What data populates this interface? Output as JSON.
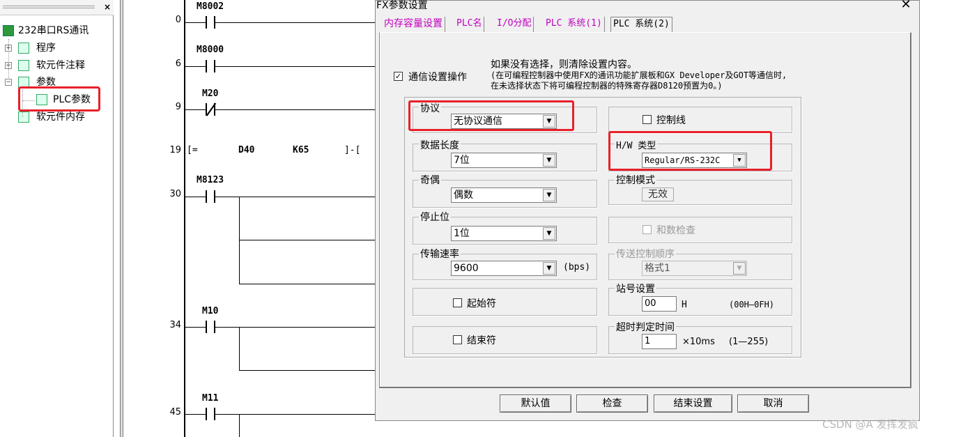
{
  "tree": {
    "close_glyph": "×",
    "root_label": "232串口RS通讯",
    "items": [
      {
        "label": "程序",
        "expander": "+"
      },
      {
        "label": "软元件注释",
        "expander": "+"
      },
      {
        "label": "参数",
        "expander": "−"
      },
      {
        "label": "PLC参数",
        "expander": ""
      },
      {
        "label": "软元件内存",
        "expander": ""
      }
    ]
  },
  "ladder": {
    "rungs": [
      {
        "step": "0",
        "device": "M8002"
      },
      {
        "step": "6",
        "device": "M8000"
      },
      {
        "step": "9",
        "device": "M20"
      },
      {
        "step": "19",
        "device": ""
      },
      {
        "step": "30",
        "device": "M8123"
      },
      {
        "step": "34",
        "device": "M10"
      },
      {
        "step": "45",
        "device": "M11"
      }
    ],
    "compare": {
      "open": "[=",
      "op1": "D40",
      "op2": "K65",
      "close": "]-["
    }
  },
  "dialog": {
    "title": "FX参数设置",
    "close_glyph": "✕",
    "tabs": [
      "内存容量设置",
      "PLC名",
      "I/O分配",
      "PLC 系统(1)",
      "PLC 系统(2)"
    ],
    "active_tab": 4,
    "comm_checkbox_label": "通信设置操作",
    "comm_checked": true,
    "note_lines": [
      "如果没有选择，则清除设置内容。",
      "(在可编程控制器中使用FX的通讯功能扩展板和GX Developer及GOT等通信时,",
      "在未选择状态下将可编程控制器的特殊寄存器D8120预置为0。)"
    ],
    "protocol": {
      "label": "协议",
      "value": "无协议通信"
    },
    "data_length": {
      "label": "数据长度",
      "value": "7位"
    },
    "parity": {
      "label": "奇偶",
      "value": "偶数"
    },
    "stop_bit": {
      "label": "停止位",
      "value": "1位"
    },
    "baud": {
      "label": "传输速率",
      "value": "9600",
      "unit": "(bps)"
    },
    "start_char": {
      "label": "起始符",
      "checked": false
    },
    "end_char": {
      "label": "结束符",
      "checked": false
    },
    "control_line": {
      "label": "控制线",
      "checked": false
    },
    "hw_type": {
      "label": "H/W 类型",
      "value": "Regular/RS-232C"
    },
    "control_mode": {
      "label": "控制模式",
      "value": "无效"
    },
    "sum_check": {
      "label": "和数检查",
      "checked": false
    },
    "transfer_seq": {
      "label": "传送控制顺序",
      "value": "格式1"
    },
    "station": {
      "label": "站号设置",
      "value": "00",
      "unit": "H",
      "range": "(00H—0FH)"
    },
    "timeout": {
      "label": "超时判定时间",
      "value": "1",
      "unit": "×10ms",
      "range": "(1—255)"
    },
    "buttons": [
      "默认值",
      "检查",
      "结束设置",
      "取消"
    ]
  },
  "watermark": "CSDN @A 发挥发疯"
}
